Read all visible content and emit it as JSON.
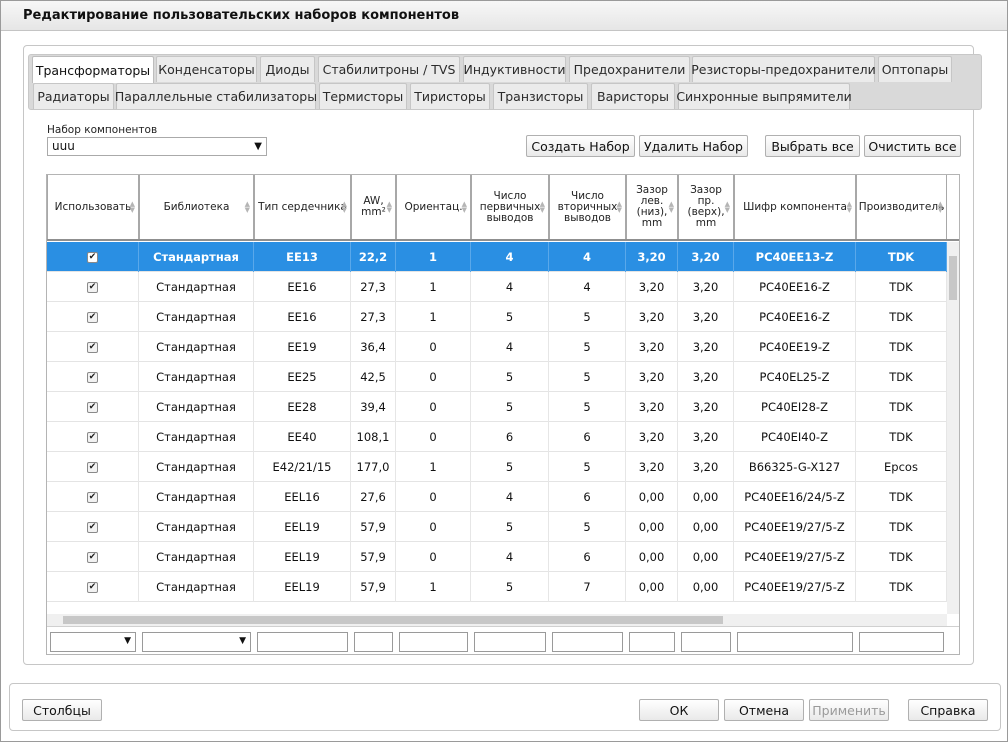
{
  "window": {
    "title": "Редактирование пользовательских наборов компонентов"
  },
  "tabs_row1": [
    "Трансформаторы",
    "Конденсаторы",
    "Диоды",
    "Стабилитроны / TVS",
    "Индуктивности",
    "Предохранители",
    "Резисторы-предохранители",
    "Оптопары"
  ],
  "tabs_row2": [
    "Радиаторы",
    "Параллельные стабилизаторы",
    "Термисторы",
    "Тиристоры",
    "Транзисторы",
    "Варисторы",
    "Синхронные выпрямители"
  ],
  "active_tab": "Трансформаторы",
  "set": {
    "label": "Набор компонентов",
    "value": "uuu"
  },
  "buttons": {
    "create": "Создать Набор",
    "delete": "Удалить Набор",
    "select_all": "Выбрать все",
    "clear_all": "Очистить все",
    "columns": "Столбцы",
    "ok": "ОК",
    "cancel": "Отмена",
    "apply": "Применить",
    "help": "Справка"
  },
  "columns": [
    "Использовать",
    "Библиотека",
    "Тип сердечника",
    "AW, mm²",
    "Ориентац.",
    "Число первичных выводов",
    "Число вторичных выводов",
    "Зазор лев. (низ), mm",
    "Зазор пр. (верх), mm",
    "Шифр компонента",
    "Производитель"
  ],
  "rows": [
    [
      "Стандартная",
      "EE13",
      "22,2",
      "1",
      "4",
      "4",
      "3,20",
      "3,20",
      "PC40EE13-Z",
      "TDK"
    ],
    [
      "Стандартная",
      "EE16",
      "27,3",
      "1",
      "4",
      "4",
      "3,20",
      "3,20",
      "PC40EE16-Z",
      "TDK"
    ],
    [
      "Стандартная",
      "EE16",
      "27,3",
      "1",
      "5",
      "5",
      "3,20",
      "3,20",
      "PC40EE16-Z",
      "TDK"
    ],
    [
      "Стандартная",
      "EE19",
      "36,4",
      "0",
      "4",
      "5",
      "3,20",
      "3,20",
      "PC40EE19-Z",
      "TDK"
    ],
    [
      "Стандартная",
      "EE25",
      "42,5",
      "0",
      "5",
      "5",
      "3,20",
      "3,20",
      "PC40EL25-Z",
      "TDK"
    ],
    [
      "Стандартная",
      "EE28",
      "39,4",
      "0",
      "5",
      "5",
      "3,20",
      "3,20",
      "PC40EI28-Z",
      "TDK"
    ],
    [
      "Стандартная",
      "EE40",
      "108,1",
      "0",
      "6",
      "6",
      "3,20",
      "3,20",
      "PC40EI40-Z",
      "TDK"
    ],
    [
      "Стандартная",
      "E42/21/15",
      "177,0",
      "1",
      "5",
      "5",
      "3,20",
      "3,20",
      "B66325-G-X127",
      "Epcos"
    ],
    [
      "Стандартная",
      "EEL16",
      "27,6",
      "0",
      "4",
      "6",
      "0,00",
      "0,00",
      "PC40EE16/24/5-Z",
      "TDK"
    ],
    [
      "Стандартная",
      "EEL19",
      "57,9",
      "0",
      "5",
      "5",
      "0,00",
      "0,00",
      "PC40EE19/27/5-Z",
      "TDK"
    ],
    [
      "Стандартная",
      "EEL19",
      "57,9",
      "0",
      "4",
      "6",
      "0,00",
      "0,00",
      "PC40EE19/27/5-Z",
      "TDK"
    ],
    [
      "Стандартная",
      "EEL19",
      "57,9",
      "1",
      "5",
      "7",
      "0,00",
      "0,00",
      "PC40EE19/27/5-Z",
      "TDK"
    ]
  ],
  "selected_row": 0,
  "colors": {
    "selection": "#2a8fe3"
  }
}
